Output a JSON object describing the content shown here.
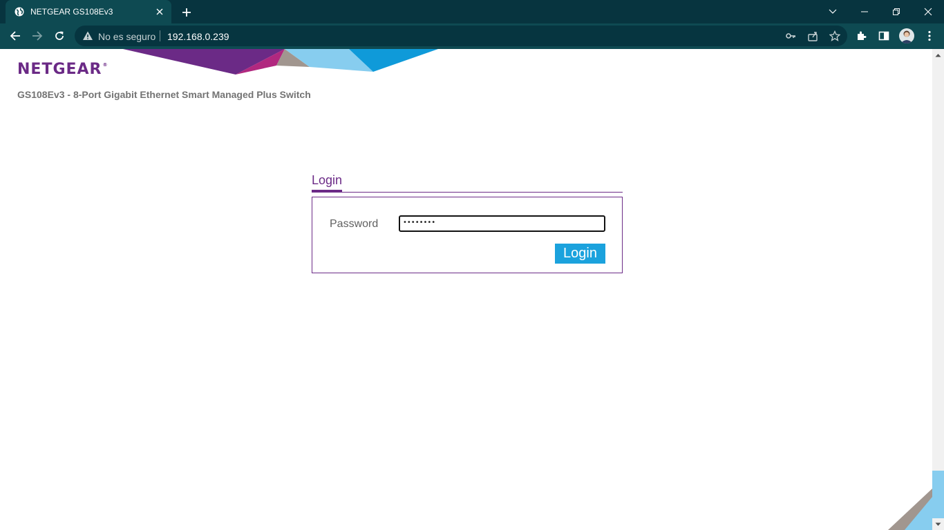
{
  "browser": {
    "tab_title": "NETGEAR GS108Ev3",
    "security_label": "No es seguro",
    "url": "192.168.0.239"
  },
  "brand": {
    "logo_text": "NETGEAR",
    "logo_mark": "®",
    "subtitle": "GS108Ev3 - 8-Port Gigabit Ethernet Smart Managed Plus Switch",
    "colors": {
      "purple": "#6b2a86",
      "blue": "#1ba2dd",
      "light_blue": "#87cdef",
      "grey": "#a1968f"
    }
  },
  "login": {
    "tab_label": "Login",
    "password_label": "Password",
    "password_value": "••••••••",
    "submit_label": "Login"
  },
  "icons": {
    "tab": [
      "globe-icon",
      "close-icon",
      "plus-icon"
    ],
    "window": [
      "chevron-down-icon",
      "minimize-icon",
      "restore-icon",
      "close-window-icon"
    ],
    "toolbar": [
      "back-icon",
      "forward-icon",
      "reload-icon",
      "warning-icon",
      "key-icon",
      "share-icon",
      "star-icon",
      "extensions-icon",
      "side-panel-icon",
      "avatar",
      "menu-icon"
    ]
  }
}
